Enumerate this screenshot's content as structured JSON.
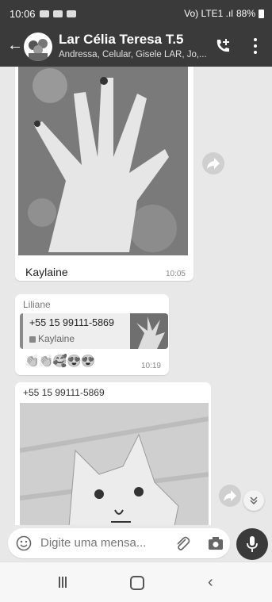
{
  "status_bar": {
    "time": "10:06",
    "battery": "88%",
    "signal": "Vo) LTE1 .ıl"
  },
  "header": {
    "title": "Lar Célia Teresa  T.5",
    "subtitle": "Andressa, Celular, Gisele LAR, Jo,..."
  },
  "messages": [
    {
      "type": "image",
      "caption": "Kaylaine",
      "time": "10:05"
    },
    {
      "type": "reply",
      "sender": "Liliane",
      "quoted_number": "+55 15 99111-5869",
      "quoted_text": "Kaylaine",
      "reactions": "👏👏🥰😍😍",
      "time": "10:19"
    },
    {
      "type": "image",
      "sender": "+55 15 99111-5869"
    }
  ],
  "composer": {
    "placeholder": "Digite uma mensa..."
  },
  "icons": {
    "back": "back-arrow-icon",
    "call": "add-call-icon",
    "menu": "more-options-icon",
    "forward": "forward-icon",
    "scroll": "chevron-down-icon",
    "emoji": "emoji-icon",
    "attach": "attach-icon",
    "camera": "camera-icon",
    "mic": "mic-icon"
  },
  "colors": {
    "header_bg": "#3a3a3a",
    "chat_bg": "#e8e8e8",
    "bubble": "#ffffff"
  }
}
